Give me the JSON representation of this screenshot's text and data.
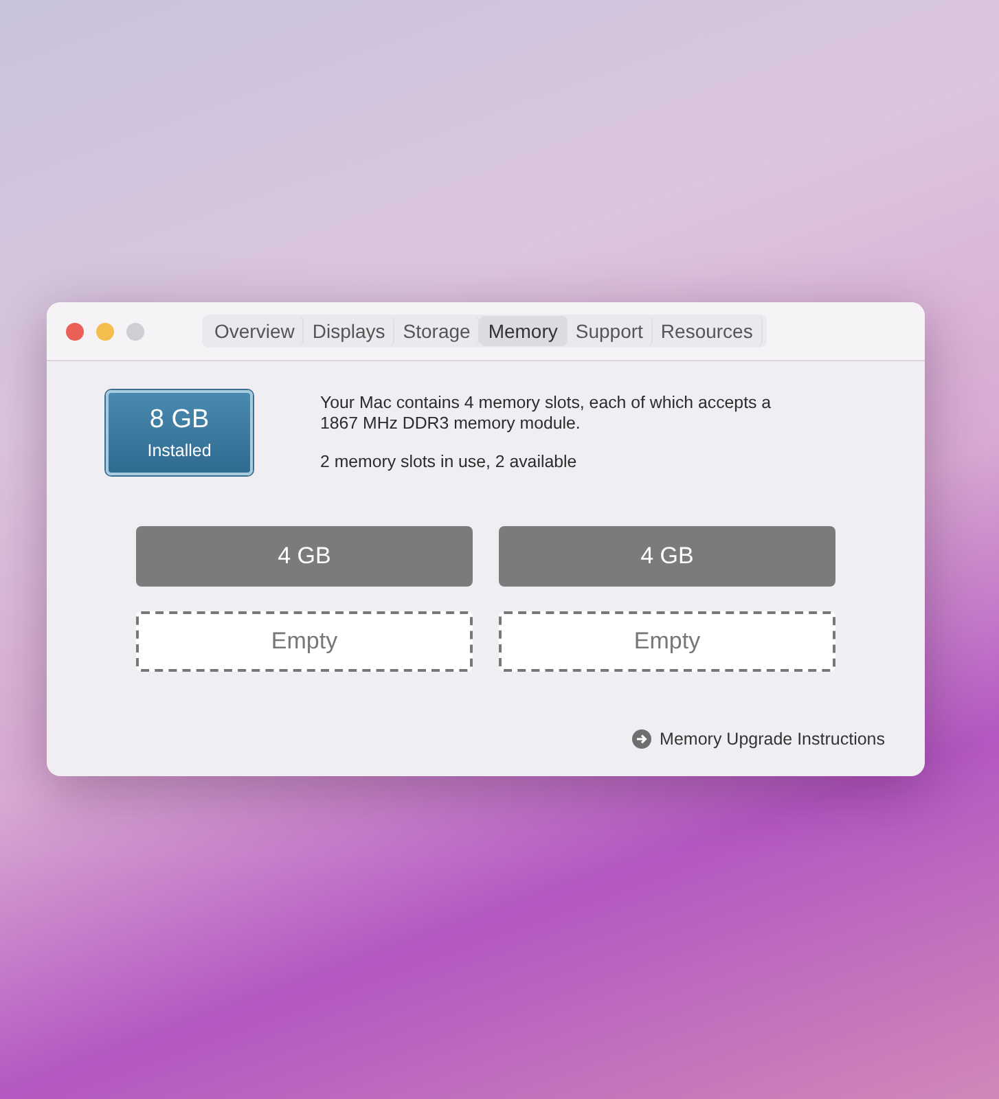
{
  "window": {
    "tabs": [
      {
        "label": "Overview",
        "selected": false
      },
      {
        "label": "Displays",
        "selected": false
      },
      {
        "label": "Storage",
        "selected": false
      },
      {
        "label": "Memory",
        "selected": true
      },
      {
        "label": "Support",
        "selected": false
      },
      {
        "label": "Resources",
        "selected": false
      }
    ]
  },
  "summary": {
    "amount": "8 GB",
    "caption": "Installed"
  },
  "description": [
    "Your Mac contains 4 memory slots, each of which accepts a 1867 MHz DDR3 memory module.",
    "2 memory slots in use, 2 available"
  ],
  "slots": [
    {
      "kind": "filled",
      "label": "4 GB"
    },
    {
      "kind": "filled",
      "label": "4 GB"
    },
    {
      "kind": "empty",
      "label": "Empty"
    },
    {
      "kind": "empty",
      "label": "Empty"
    }
  ],
  "link": "Memory Upgrade Instructions"
}
